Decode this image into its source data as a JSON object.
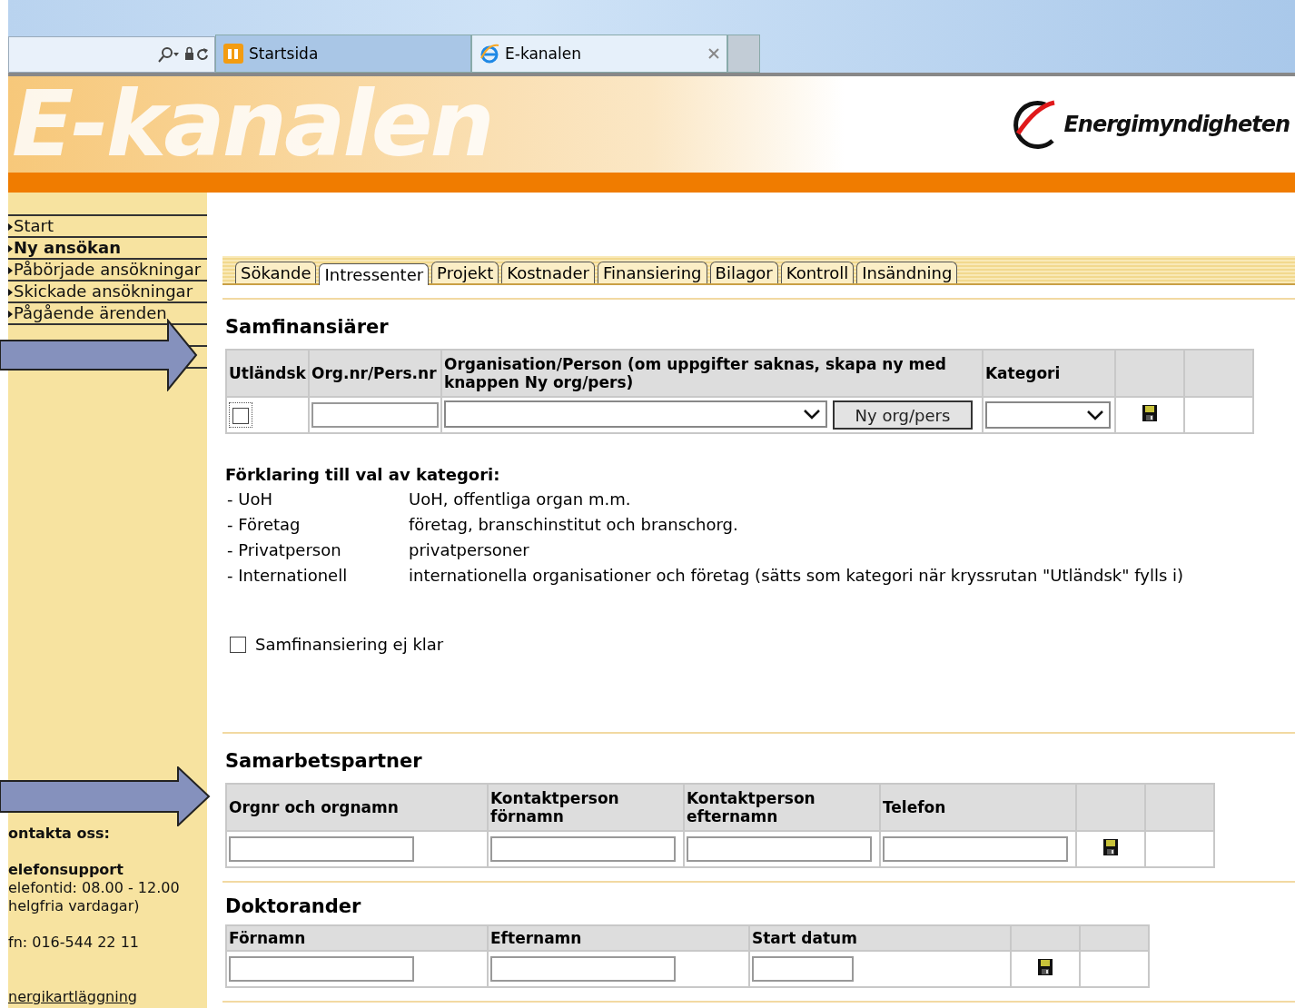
{
  "browser": {
    "tabs": [
      {
        "label": "Startsida",
        "selected": false,
        "closable": false
      },
      {
        "label": "E-kanalen",
        "selected": true,
        "closable": true
      }
    ]
  },
  "header": {
    "banner": "E-kanalen",
    "logo_text": "Energimyndigheten"
  },
  "sidebar": {
    "items": [
      {
        "label": "Start",
        "selected": false
      },
      {
        "label": "Ny ansökan",
        "selected": true
      },
      {
        "label": "Påbörjade ansökningar",
        "selected": false
      },
      {
        "label": "Skickade ansökningar",
        "selected": false
      },
      {
        "label": "Pågående ärenden",
        "selected": false
      }
    ],
    "contact_title": "ontakta oss:",
    "support_title": "elefonsupport",
    "support_lines": [
      "elefontid: 08.00 - 12.00",
      "helgfria vardagar)"
    ],
    "phone": "fn: 016-544 22 11",
    "link": "nergikartläggning"
  },
  "tabs": [
    {
      "label": "Sökande",
      "selected": false
    },
    {
      "label": "Intressenter",
      "selected": true
    },
    {
      "label": "Projekt",
      "selected": false
    },
    {
      "label": "Kostnader",
      "selected": false
    },
    {
      "label": "Finansiering",
      "selected": false
    },
    {
      "label": "Bilagor",
      "selected": false
    },
    {
      "label": "Kontroll",
      "selected": false
    },
    {
      "label": "Insändning",
      "selected": false
    }
  ],
  "cofinanciers": {
    "title": "Samfinansiärer",
    "columns": [
      "Utländsk",
      "Org.nr/Pers.nr",
      "Organisation/Person (om uppgifter saknas, skapa ny med knappen Ny org/pers)",
      "Kategori"
    ],
    "foreign_checked": false,
    "new_button": "Ny org/pers",
    "legend_title": "Förklaring till val av kategori:",
    "legend": [
      {
        "term": "- UoH",
        "text": "UoH, offentliga organ m.m."
      },
      {
        "term": "- Företag",
        "text": "företag, branschinstitut och branschorg."
      },
      {
        "term": "- Privatperson",
        "text": "privatpersoner"
      },
      {
        "term": "- Internationell",
        "text": "internationella organisationer och företag (sätts som kategori när kryssrutan \"Utländsk\" fylls i)"
      }
    ],
    "not_ready": {
      "label": "Samfinansiering ej klar",
      "checked": false
    }
  },
  "partners": {
    "title": "Samarbetspartner",
    "columns": [
      "Orgnr och orgnamn",
      "Kontaktperson förnamn",
      "Kontaktperson efternamn",
      "Telefon"
    ]
  },
  "doctoral": {
    "title": "Doktorander",
    "columns": [
      "Förnamn",
      "Efternamn",
      "Start datum"
    ]
  }
}
